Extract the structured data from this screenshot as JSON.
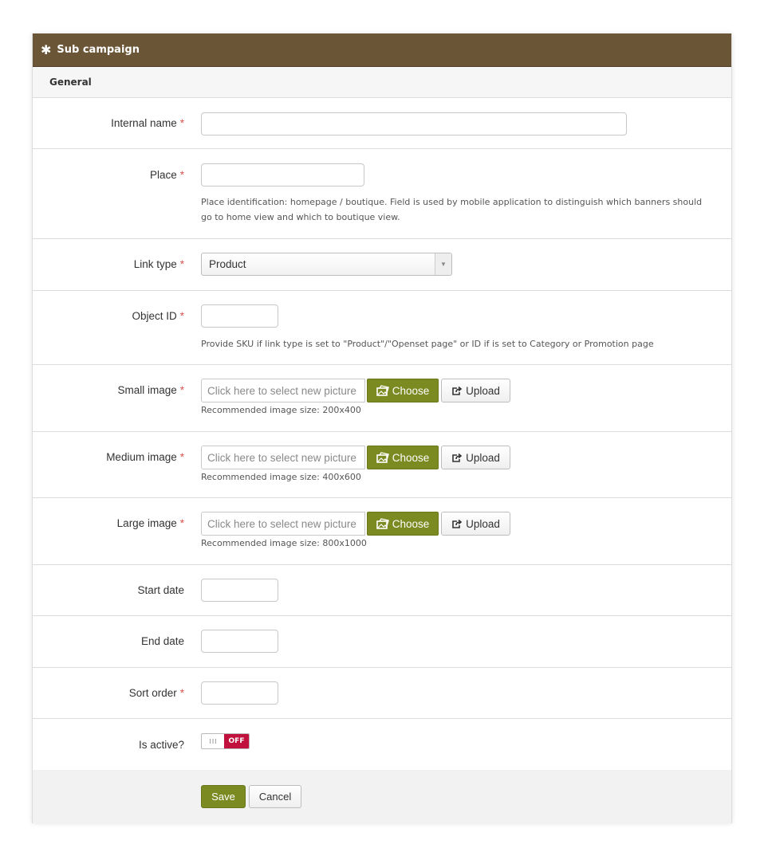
{
  "header": {
    "title": "Sub campaign",
    "icon": "asterisk-icon",
    "background": "#6a5537"
  },
  "section": {
    "title": "General"
  },
  "required_mark": "*",
  "fields": {
    "internal_name": {
      "label": "Internal name",
      "value": ""
    },
    "place": {
      "label": "Place",
      "value": "",
      "help": "Place identification: homepage / boutique. Field is used by mobile application to distinguish which banners should go to home view and which to boutique view."
    },
    "link_type": {
      "label": "Link type",
      "selected": "Product"
    },
    "object_id": {
      "label": "Object ID",
      "value": "",
      "help": "Provide SKU if link type is set to \"Product\"/\"Openset page\" or ID if is set to Category or Promotion page"
    },
    "small_image": {
      "label": "Small image",
      "placeholder": "Click here to select new picture",
      "choose": "Choose",
      "upload": "Upload",
      "recommended": "Recommended image size: 200x400"
    },
    "medium_image": {
      "label": "Medium image",
      "placeholder": "Click here to select new picture",
      "choose": "Choose",
      "upload": "Upload",
      "recommended": "Recommended image size: 400x600"
    },
    "large_image": {
      "label": "Large image",
      "placeholder": "Click here to select new picture",
      "choose": "Choose",
      "upload": "Upload",
      "recommended": "Recommended image size: 800x1000"
    },
    "start_date": {
      "label": "Start date",
      "value": ""
    },
    "end_date": {
      "label": "End date",
      "value": ""
    },
    "sort_order": {
      "label": "Sort order",
      "value": ""
    },
    "is_active": {
      "label": "Is active?",
      "state": "OFF",
      "grip": "III",
      "off_color": "#c0123c"
    }
  },
  "actions": {
    "save": "Save",
    "cancel": "Cancel",
    "accent": "#7b8a21"
  }
}
